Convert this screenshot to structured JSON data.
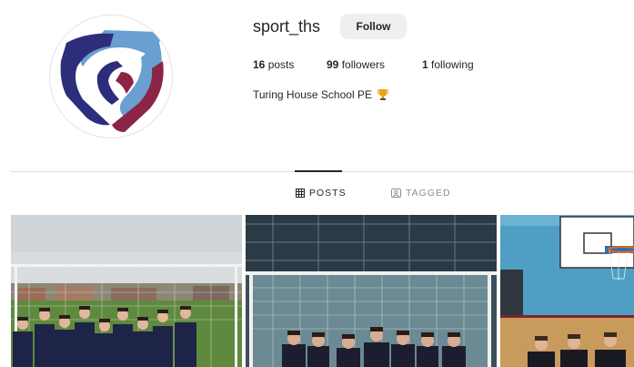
{
  "profile": {
    "username": "sport_ths",
    "follow_label": "Follow",
    "stats": {
      "posts_count": "16",
      "posts_label": "posts",
      "followers_count": "99",
      "followers_label": "followers",
      "following_count": "1",
      "following_label": "following"
    },
    "bio": "Turing House School PE",
    "bio_emoji_icon": "trophy-icon"
  },
  "tabs": [
    {
      "label": "POSTS",
      "icon": "grid-icon",
      "active": true
    },
    {
      "label": "TAGGED",
      "icon": "tag-icon",
      "active": false
    }
  ],
  "posts": [
    {
      "subject": "football team photo on grass pitch"
    },
    {
      "subject": "students posing in netted cage"
    },
    {
      "subject": "students in sports hall with basketball hoop"
    }
  ],
  "colors": {
    "logo_light_blue": "#6a9fd1",
    "logo_navy": "#2c2e7c",
    "logo_maroon": "#8c2545",
    "button_bg": "#efefef",
    "muted_text": "#8e8e8e"
  }
}
